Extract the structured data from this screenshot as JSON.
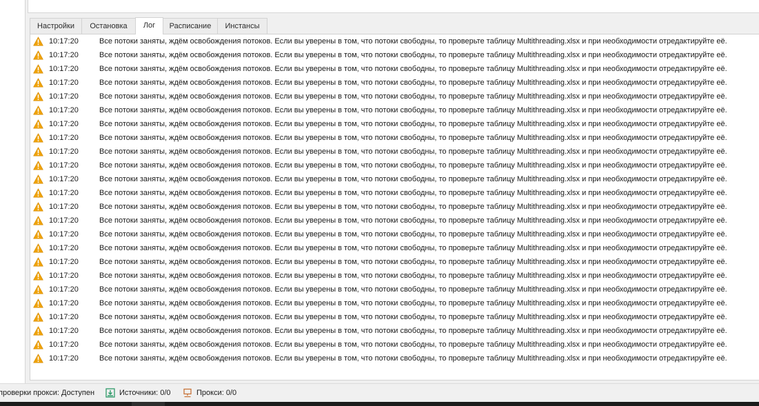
{
  "tabs": [
    {
      "label": "Настройки",
      "active": false
    },
    {
      "label": "Остановка",
      "active": false
    },
    {
      "label": "Лог",
      "active": true
    },
    {
      "label": "Расписание",
      "active": false
    },
    {
      "label": "Инстансы",
      "active": false
    }
  ],
  "log": {
    "entries": [
      {
        "level": "warning",
        "time": "10:17:20",
        "message": "Все потоки заняты, ждём освобождения потоков. Если вы уверены в том, что потоки свободны, то проверьте таблицу Multithreading.xlsx и при необходимости отредактируйте её."
      },
      {
        "level": "warning",
        "time": "10:17:20",
        "message": "Все потоки заняты, ждём освобождения потоков. Если вы уверены в том, что потоки свободны, то проверьте таблицу Multithreading.xlsx и при необходимости отредактируйте её."
      },
      {
        "level": "warning",
        "time": "10:17:20",
        "message": "Все потоки заняты, ждём освобождения потоков. Если вы уверены в том, что потоки свободны, то проверьте таблицу Multithreading.xlsx и при необходимости отредактируйте её."
      },
      {
        "level": "warning",
        "time": "10:17:20",
        "message": "Все потоки заняты, ждём освобождения потоков. Если вы уверены в том, что потоки свободны, то проверьте таблицу Multithreading.xlsx и при необходимости отредактируйте её."
      },
      {
        "level": "warning",
        "time": "10:17:20",
        "message": "Все потоки заняты, ждём освобождения потоков. Если вы уверены в том, что потоки свободны, то проверьте таблицу Multithreading.xlsx и при необходимости отредактируйте её."
      },
      {
        "level": "warning",
        "time": "10:17:20",
        "message": "Все потоки заняты, ждём освобождения потоков. Если вы уверены в том, что потоки свободны, то проверьте таблицу Multithreading.xlsx и при необходимости отредактируйте её."
      },
      {
        "level": "warning",
        "time": "10:17:20",
        "message": "Все потоки заняты, ждём освобождения потоков. Если вы уверены в том, что потоки свободны, то проверьте таблицу Multithreading.xlsx и при необходимости отредактируйте её."
      },
      {
        "level": "warning",
        "time": "10:17:20",
        "message": "Все потоки заняты, ждём освобождения потоков. Если вы уверены в том, что потоки свободны, то проверьте таблицу Multithreading.xlsx и при необходимости отредактируйте её."
      },
      {
        "level": "warning",
        "time": "10:17:20",
        "message": "Все потоки заняты, ждём освобождения потоков. Если вы уверены в том, что потоки свободны, то проверьте таблицу Multithreading.xlsx и при необходимости отредактируйте её."
      },
      {
        "level": "warning",
        "time": "10:17:20",
        "message": "Все потоки заняты, ждём освобождения потоков. Если вы уверены в том, что потоки свободны, то проверьте таблицу Multithreading.xlsx и при необходимости отредактируйте её."
      },
      {
        "level": "warning",
        "time": "10:17:20",
        "message": "Все потоки заняты, ждём освобождения потоков. Если вы уверены в том, что потоки свободны, то проверьте таблицу Multithreading.xlsx и при необходимости отредактируйте её."
      },
      {
        "level": "warning",
        "time": "10:17:20",
        "message": "Все потоки заняты, ждём освобождения потоков. Если вы уверены в том, что потоки свободны, то проверьте таблицу Multithreading.xlsx и при необходимости отредактируйте её."
      },
      {
        "level": "warning",
        "time": "10:17:20",
        "message": "Все потоки заняты, ждём освобождения потоков. Если вы уверены в том, что потоки свободны, то проверьте таблицу Multithreading.xlsx и при необходимости отредактируйте её."
      },
      {
        "level": "warning",
        "time": "10:17:20",
        "message": "Все потоки заняты, ждём освобождения потоков. Если вы уверены в том, что потоки свободны, то проверьте таблицу Multithreading.xlsx и при необходимости отредактируйте её."
      },
      {
        "level": "warning",
        "time": "10:17:20",
        "message": "Все потоки заняты, ждём освобождения потоков. Если вы уверены в том, что потоки свободны, то проверьте таблицу Multithreading.xlsx и при необходимости отредактируйте её."
      },
      {
        "level": "warning",
        "time": "10:17:20",
        "message": "Все потоки заняты, ждём освобождения потоков. Если вы уверены в том, что потоки свободны, то проверьте таблицу Multithreading.xlsx и при необходимости отредактируйте её."
      },
      {
        "level": "warning",
        "time": "10:17:20",
        "message": "Все потоки заняты, ждём освобождения потоков. Если вы уверены в том, что потоки свободны, то проверьте таблицу Multithreading.xlsx и при необходимости отредактируйте её."
      },
      {
        "level": "warning",
        "time": "10:17:20",
        "message": "Все потоки заняты, ждём освобождения потоков. Если вы уверены в том, что потоки свободны, то проверьте таблицу Multithreading.xlsx и при необходимости отредактируйте её."
      },
      {
        "level": "warning",
        "time": "10:17:20",
        "message": "Все потоки заняты, ждём освобождения потоков. Если вы уверены в том, что потоки свободны, то проверьте таблицу Multithreading.xlsx и при необходимости отредактируйте её."
      },
      {
        "level": "warning",
        "time": "10:17:20",
        "message": "Все потоки заняты, ждём освобождения потоков. Если вы уверены в том, что потоки свободны, то проверьте таблицу Multithreading.xlsx и при необходимости отредактируйте её."
      },
      {
        "level": "warning",
        "time": "10:17:20",
        "message": "Все потоки заняты, ждём освобождения потоков. Если вы уверены в том, что потоки свободны, то проверьте таблицу Multithreading.xlsx и при необходимости отредактируйте её."
      },
      {
        "level": "warning",
        "time": "10:17:20",
        "message": "Все потоки заняты, ждём освобождения потоков. Если вы уверены в том, что потоки свободны, то проверьте таблицу Multithreading.xlsx и при необходимости отредактируйте её."
      },
      {
        "level": "warning",
        "time": "10:17:20",
        "message": "Все потоки заняты, ждём освобождения потоков. Если вы уверены в том, что потоки свободны, то проверьте таблицу Multithreading.xlsx и при необходимости отредактируйте её."
      },
      {
        "level": "warning",
        "time": "10:17:20",
        "message": "Все потоки заняты, ждём освобождения потоков. Если вы уверены в том, что потоки свободны, то проверьте таблицу Multithreading.xlsx и при необходимости отредактируйте её."
      }
    ],
    "warning_icon": "warning-triangle-icon",
    "warning_color": "#f0a30a"
  },
  "statusbar": {
    "proxy_check": "проверки прокси: Доступен",
    "sources_icon": "download-icon",
    "sources": "Источники: 0/0",
    "sources_icon_color": "#2e9b6a",
    "proxy_icon": "network-icon",
    "proxy": "Прокси: 0/0",
    "proxy_icon_color": "#c8743a"
  }
}
